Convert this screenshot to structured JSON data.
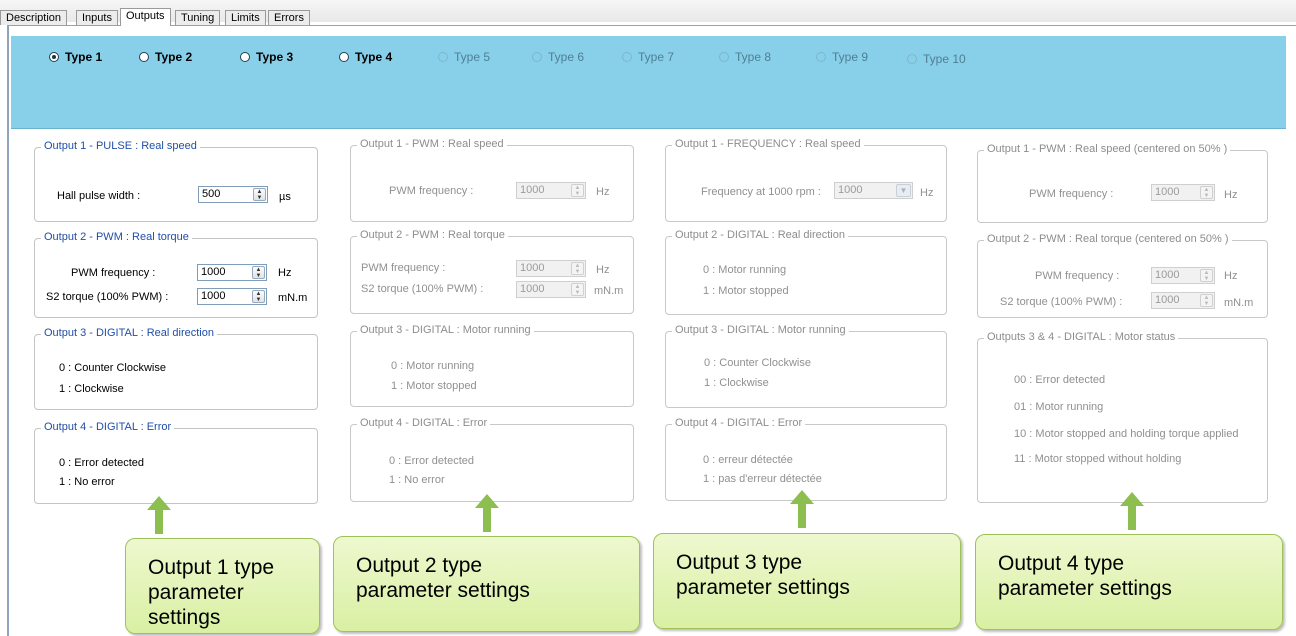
{
  "tabs": [
    "Description",
    "Inputs",
    "Outputs",
    "Tuning",
    "Limits",
    "Errors"
  ],
  "active_tab": "Outputs",
  "types": [
    {
      "label": "Type 1",
      "checked": true,
      "enabled": true
    },
    {
      "label": "Type 2",
      "checked": false,
      "enabled": true
    },
    {
      "label": "Type 3",
      "checked": false,
      "enabled": true
    },
    {
      "label": "Type 4",
      "checked": false,
      "enabled": true
    },
    {
      "label": "Type 5",
      "checked": false,
      "enabled": false
    },
    {
      "label": "Type 6",
      "checked": false,
      "enabled": false
    },
    {
      "label": "Type 7",
      "checked": false,
      "enabled": false
    },
    {
      "label": "Type 8",
      "checked": false,
      "enabled": false
    },
    {
      "label": "Type 9",
      "checked": false,
      "enabled": false
    },
    {
      "label": "Type 10",
      "checked": false,
      "enabled": false
    }
  ],
  "col1": {
    "g1": {
      "title": "Output 1 - PULSE : Real speed",
      "label": "Hall pulse width :",
      "value": "500",
      "unit": "µs"
    },
    "g2": {
      "title": "Output 2 - PWM : Real torque",
      "label1": "PWM  frequency :",
      "value1": "1000",
      "unit1": "Hz",
      "label2": "S2 torque (100% PWM) :",
      "value2": "1000",
      "unit2": "mN.m"
    },
    "g3": {
      "title": "Output 3 - DIGITAL : Real direction",
      "line1": "0 : Counter Clockwise",
      "line2": "1 : Clockwise"
    },
    "g4": {
      "title": "Output 4 - DIGITAL : Error",
      "line1": "0 : Error detected",
      "line2": "1 : No error"
    }
  },
  "col2": {
    "g1": {
      "title": "Output 1 - PWM : Real speed",
      "label": "PWM frequency :",
      "value": "1000",
      "unit": "Hz"
    },
    "g2": {
      "title": "Output 2 - PWM : Real torque",
      "label1": "PWM  frequency :",
      "value1": "1000",
      "unit1": "Hz",
      "label2": "S2 torque (100% PWM) :",
      "value2": "1000",
      "unit2": "mN.m"
    },
    "g3": {
      "title": "Output 3 - DIGITAL : Motor running",
      "line1": "0 : Motor running",
      "line2": "1 :  Motor stopped"
    },
    "g4": {
      "title": "Output 4 - DIGITAL : Error",
      "line1": "0 : Error detected",
      "line2": "1 : No error"
    }
  },
  "col3": {
    "g1": {
      "title": "Output 1 - FREQUENCY : Real speed",
      "label": "Frequency at 1000  rpm :",
      "value": "1000",
      "unit": "Hz"
    },
    "g2": {
      "title": "Output 2 - DIGITAL : Real direction",
      "line1": "0 : Motor running",
      "line2": "1 :  Motor stopped"
    },
    "g3": {
      "title": "Output 3 - DIGITAL : Motor running",
      "line1": "0 : Counter Clockwise",
      "line2": "1 : Clockwise"
    },
    "g4": {
      "title": "Output 4 - DIGITAL : Error",
      "line1": "0 : erreur détectée",
      "line2": "1 : pas d'erreur détectée"
    }
  },
  "col4": {
    "g1": {
      "title": "Output 1 - PWM : Real speed (centered on 50% )",
      "label": "PWM frequency :",
      "value": "1000",
      "unit": "Hz"
    },
    "g2": {
      "title": "Output 2 - PWM : Real torque (centered on 50% )",
      "label1": "PWM frequency :",
      "value1": "1000",
      "unit1": "Hz",
      "label2": "S2 torque (100% PWM) :",
      "value2": "1000",
      "unit2": "mN.m"
    },
    "g3": {
      "title": "Outputs 3 & 4 - DIGITAL : Motor status",
      "line1": "00 : Error detected",
      "line2": "01 : Motor running",
      "line3": "10 : Motor stopped and holding torque applied",
      "line4": "11 : Motor stopped without holding"
    }
  },
  "callouts": [
    {
      "line1": "Output 1 type",
      "line2": "parameter settings"
    },
    {
      "line1": "Output 2 type",
      "line2": "parameter settings"
    },
    {
      "line1": "Output 3 type",
      "line2": "parameter settings"
    },
    {
      "line1": "Output 4 type",
      "line2": "parameter settings"
    }
  ],
  "colors": {
    "type_bar": "#88cfe9",
    "callout_fill": "#d9f0a3",
    "arrow": "#8cbf4f",
    "active_legend": "#1f4fa8"
  }
}
